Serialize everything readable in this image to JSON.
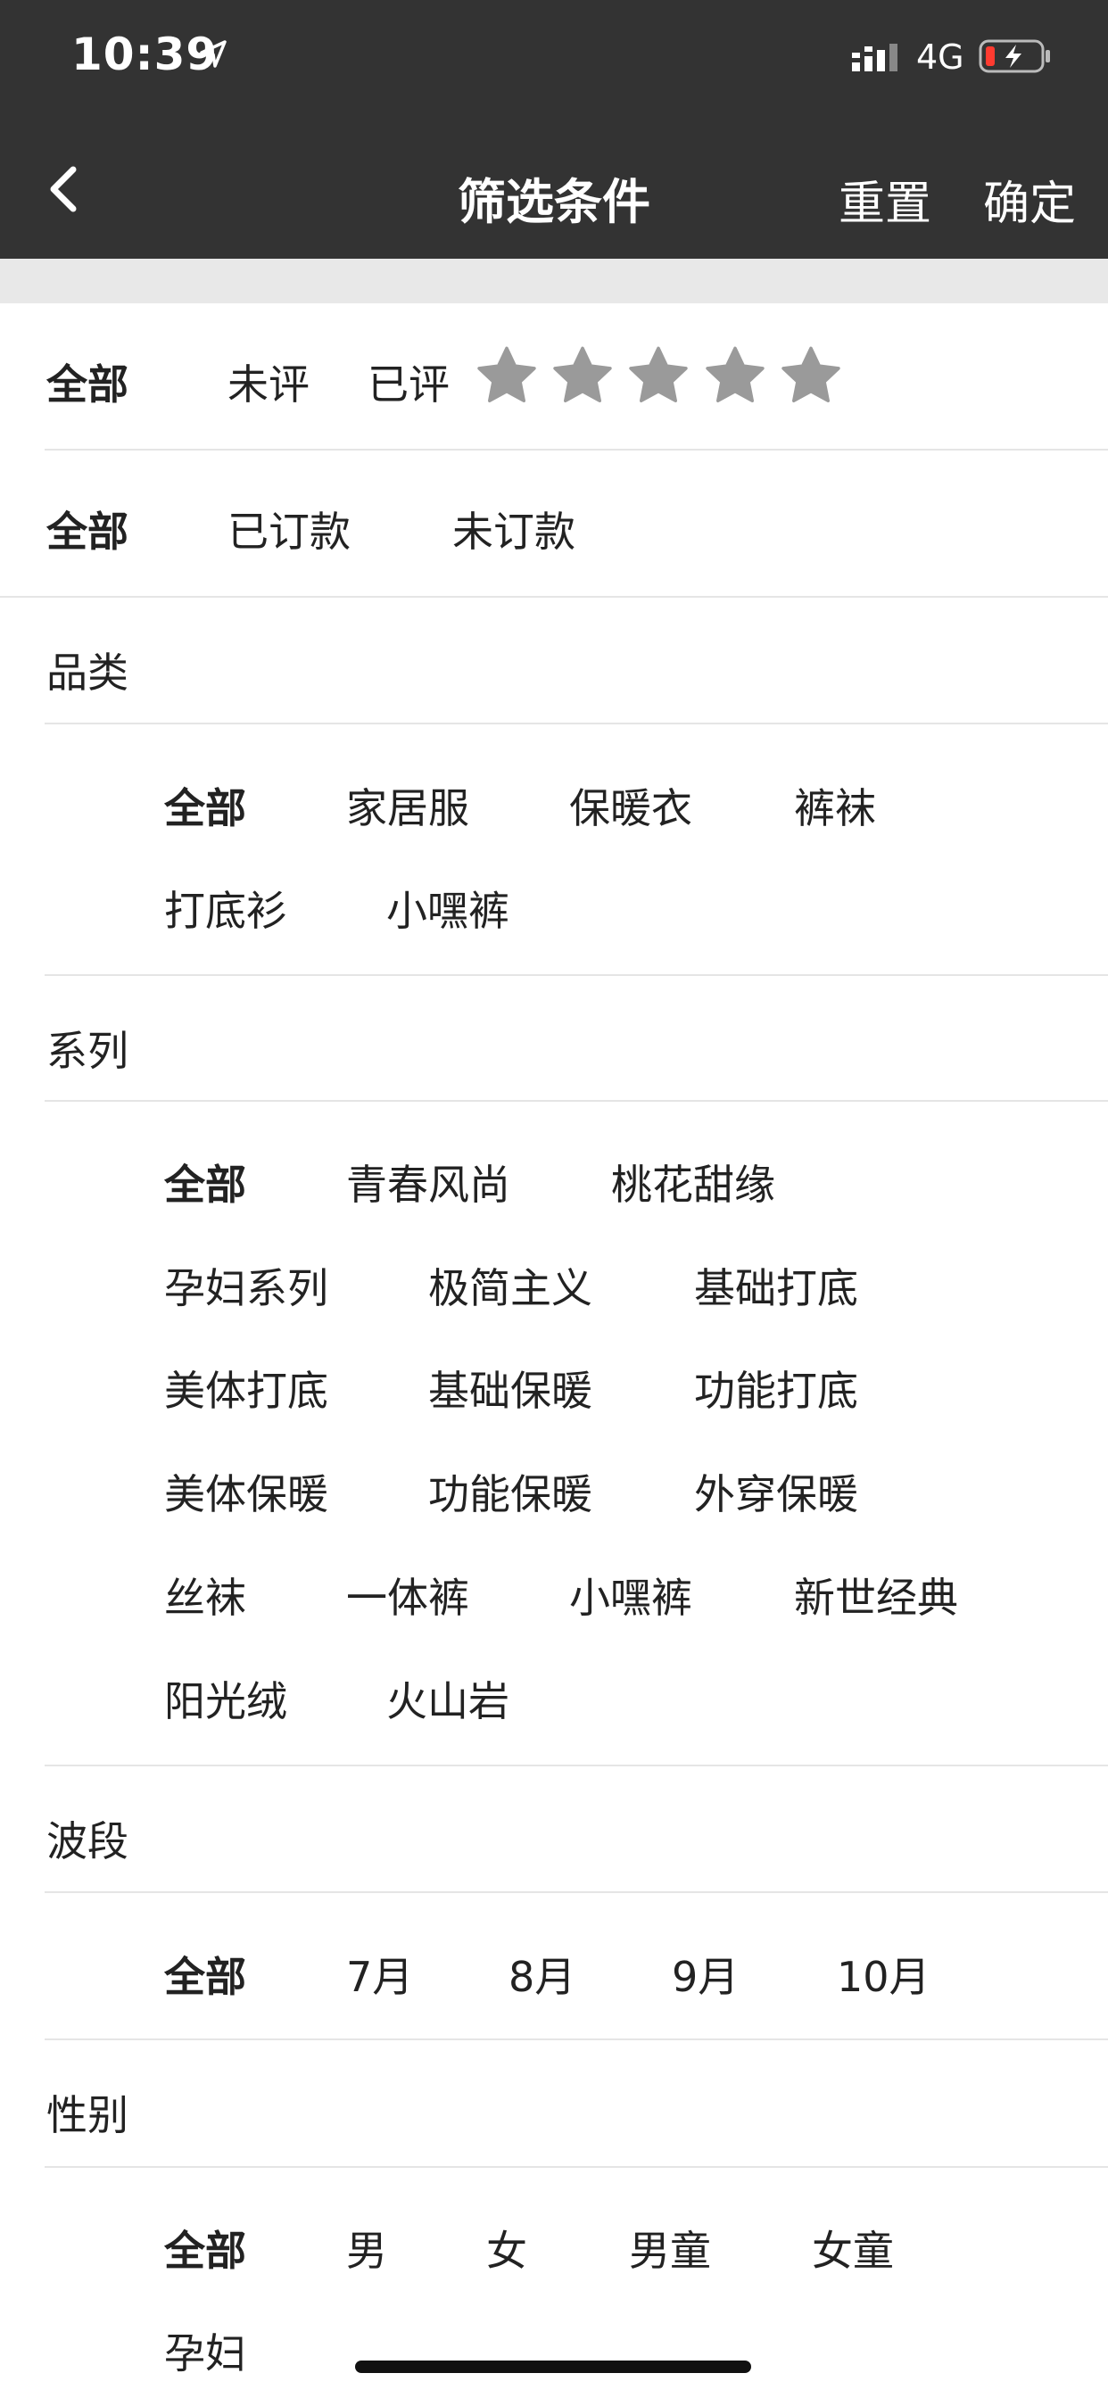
{
  "status_bar": {
    "time": "10:39",
    "network": "4G"
  },
  "nav": {
    "title": "筛选条件",
    "reset": "重置",
    "confirm": "确定"
  },
  "rating_filter": {
    "all": "全部",
    "not_rated": "未评",
    "rated": "已评",
    "stars": 5
  },
  "order_filter": {
    "all": "全部",
    "ordered": "已订款",
    "not_ordered": "未订款"
  },
  "category": {
    "title": "品类",
    "options": [
      "全部",
      "家居服",
      "保暖衣",
      "裤袜",
      "打底衫",
      "小嘿裤"
    ]
  },
  "series": {
    "title": "系列",
    "options": [
      "全部",
      "青春风尚",
      "桃花甜缘",
      "孕妇系列",
      "极简主义",
      "基础打底",
      "美体打底",
      "基础保暖",
      "功能打底",
      "美体保暖",
      "功能保暖",
      "外穿保暖",
      "丝袜",
      "一体裤",
      "小嘿裤",
      "新世经典",
      "阳光绒",
      "火山岩"
    ]
  },
  "wave": {
    "title": "波段",
    "options": [
      "全部",
      "7月",
      "8月",
      "9月",
      "10月"
    ]
  },
  "gender": {
    "title": "性别",
    "options": [
      "全部",
      "男",
      "女",
      "男童",
      "女童",
      "孕妇"
    ]
  },
  "colors": {
    "header_bg": "#333333",
    "star": "#9a9a9a",
    "divider": "#e5e5e5",
    "gap": "#e8e8e8"
  }
}
